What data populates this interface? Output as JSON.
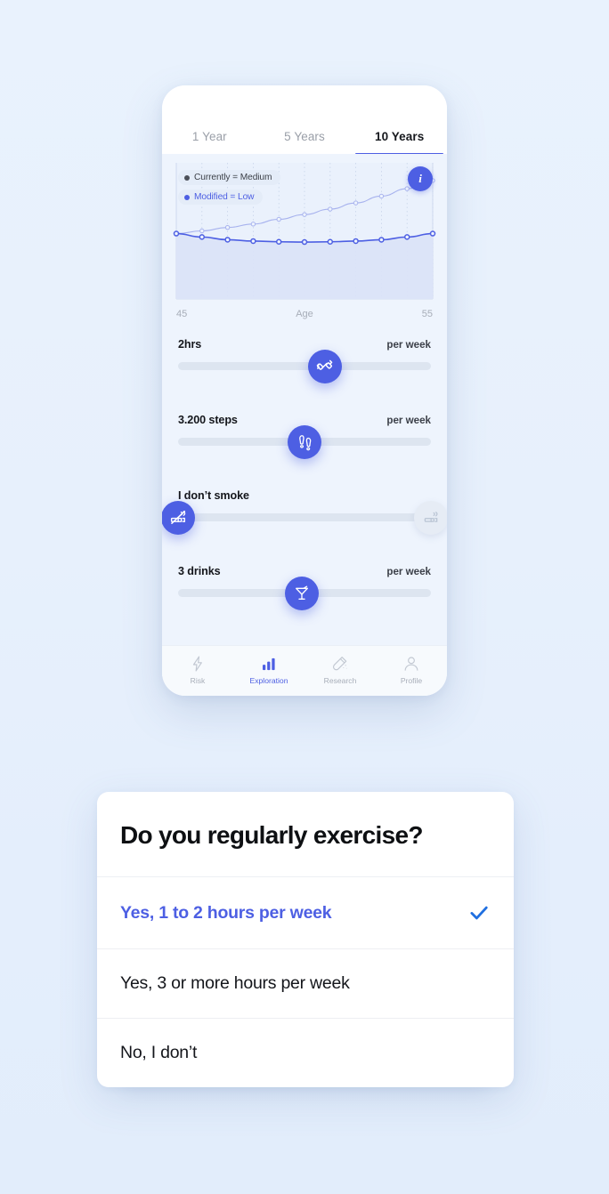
{
  "theme": {
    "accent": "#4d5fe3",
    "page_bg": "#e8f1fc",
    "panel_bg": "#eef4fd",
    "leaf_teal": "#6fd9c4",
    "leaf_mint": "#8ee6d2",
    "leaf_blue": "#8fc0e8",
    "check_blue": "#1f6fe0"
  },
  "phone": {
    "tabs": [
      {
        "label": "1 Year",
        "active": false
      },
      {
        "label": "5 Years",
        "active": false
      },
      {
        "label": "10 Years",
        "active": true
      }
    ],
    "info_button": {
      "label": "i",
      "icon": "info-icon"
    },
    "legend": [
      {
        "label": "Currently = Medium",
        "color": "#4b4f58"
      },
      {
        "label": "Modified = Low",
        "color": "#4d5fe3"
      }
    ],
    "axis": {
      "left_tick": "45",
      "center_label": "Age",
      "right_tick": "55"
    },
    "sliders": [
      {
        "name": "exercise",
        "value_label": "2hrs",
        "unit_label": "per week",
        "icon": "dumbbell-icon",
        "thumb_percent": 58
      },
      {
        "name": "steps",
        "value_label": "3.200 steps",
        "unit_label": "per week",
        "icon": "footsteps-icon",
        "thumb_percent": 50
      },
      {
        "name": "smoking",
        "value_label": "I don’t smoke",
        "unit_label": "",
        "icon": "no-smoking-icon",
        "end_icon": "cigarette-icon",
        "thumb_percent": 0
      },
      {
        "name": "drinks",
        "value_label": "3 drinks",
        "unit_label": "per week",
        "icon": "cocktail-icon",
        "thumb_percent": 50
      }
    ],
    "bottom_nav": [
      {
        "label": "Risk",
        "icon": "lightning-bolt-icon",
        "active": false
      },
      {
        "label": "Exploration",
        "icon": "bar-chart-icon",
        "active": true
      },
      {
        "label": "Research",
        "icon": "test-tube-icon",
        "active": false
      },
      {
        "label": "Profile",
        "icon": "person-icon",
        "active": false
      }
    ]
  },
  "chart_data": {
    "type": "line",
    "title": "",
    "xlabel": "Age",
    "ylabel": "",
    "x": [
      45,
      46,
      47,
      48,
      49,
      50,
      51,
      52,
      53,
      54,
      55
    ],
    "xlim": [
      45,
      55
    ],
    "ylim": [
      0,
      100
    ],
    "grid": "vertical-dotted",
    "legend_position": "top-left",
    "series": [
      {
        "name": "Currently = Medium",
        "color": "#a7b2ee",
        "values": [
          48,
          50,
          52.5,
          55,
          58.5,
          62,
          66,
          70.5,
          75.5,
          81,
          87
        ]
      },
      {
        "name": "Modified = Low",
        "color": "#4d5fe3",
        "values": [
          48,
          45.5,
          43.5,
          42.5,
          42,
          41.8,
          42,
          42.5,
          43.5,
          45.5,
          48
        ],
        "filled": true
      }
    ]
  },
  "dialog": {
    "title": "Do you regularly exercise?",
    "options": [
      {
        "label": "Yes, 1 to 2 hours per week",
        "selected": true
      },
      {
        "label": "Yes, 3 or more hours per week",
        "selected": false
      },
      {
        "label": "No, I don’t",
        "selected": false
      }
    ],
    "check_icon": "checkmark-icon"
  }
}
